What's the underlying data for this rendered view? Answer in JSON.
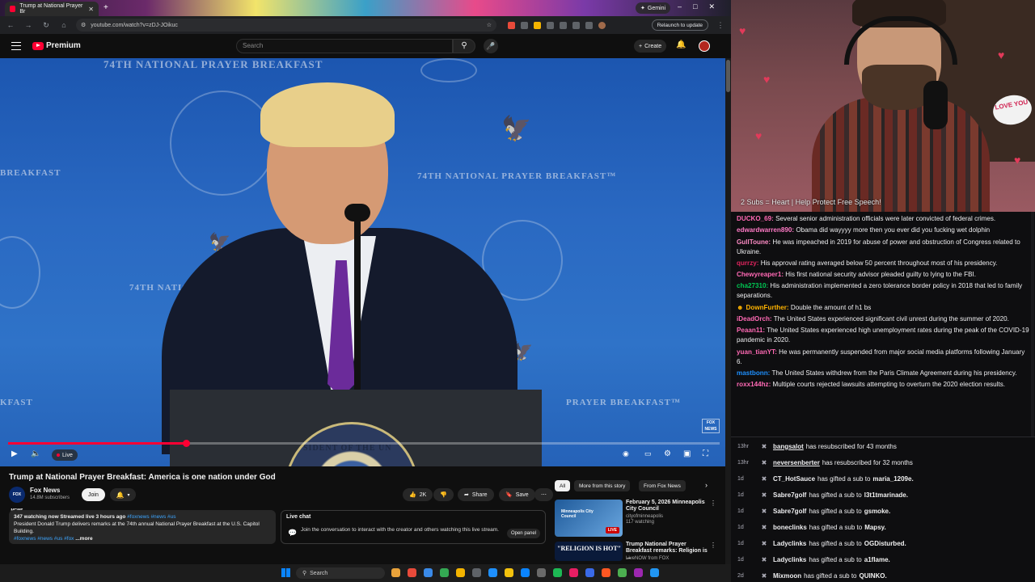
{
  "browser": {
    "tab_title": "Trump at National Prayer Br",
    "new_tab": "+",
    "url": "youtube.com/watch?v=zDJ-JOikuc",
    "gemini_label": "Gemini",
    "relaunch_label": "Relaunch to update",
    "window_controls": [
      "–",
      "□",
      "✕"
    ]
  },
  "youtube": {
    "logo_text": "Premium",
    "search_placeholder": "Search",
    "create_label": "Create",
    "video": {
      "banners": [
        "74TH NATIONAL PRAYER BREAKFAST",
        "74TH NATIONAL PRAYER BREAKFAST™",
        "74TH NATIO",
        "BREAKFAST",
        "KFAST",
        "PRAYER BREAKFAST™"
      ],
      "podium_text": "SIDENT OF THE UN",
      "fox_bug": "FOX NEWS",
      "progress_fraction": 0.25,
      "live_label": "Live"
    },
    "title": "Trump at National Prayer Breakfast: America is one nation under God",
    "channel": {
      "name": "Fox News",
      "avatar_text": "FOX NEWS",
      "subscribers": "14.8M subscribers",
      "join_label": "Join"
    },
    "actions": {
      "likes": "2K",
      "share": "Share",
      "save": "Save",
      "more": "⋯"
    },
    "description": {
      "meta": "347 watching now  Streamed live 3 hours ago",
      "meta_tags": "#foxnews #news #us",
      "text": "President Donald Trump delivers remarks at the 74th annual National Prayer Breakfast at the U.S. Capitol Building.",
      "tags": "#foxnews #news #us #fox",
      "more": "...more"
    },
    "live_chat": {
      "title": "Live chat",
      "text": "Join the conversation to interact with the creator and others watching this live stream.",
      "open_panel": "Open panel"
    },
    "chips": [
      "All",
      "More from this story",
      "From Fox News"
    ],
    "recommendations": [
      {
        "title": "February 5, 2026 Minneapolis City Council",
        "channel": "cityofminneapolis",
        "meta": "117 watching",
        "thumb_text": "Minneapolis City Council",
        "live": "LIVE",
        "accent": "#2f6fb0"
      },
      {
        "title": "Trump National Prayer Breakfast remarks: Religion is ...",
        "channel": "LiveNOW from FOX",
        "meta": "",
        "thumb_text": "\"RELIGION IS HOT\"",
        "live": "",
        "accent": "#0a1a3a"
      }
    ]
  },
  "taskbar": {
    "search_label": "Search",
    "icon_colors": [
      "#e8a23a",
      "#e84a3a",
      "#3a8ae8",
      "#34a853",
      "#f4b400",
      "#5f6368",
      "#1e90ff",
      "#f4c20d",
      "#0a84ff",
      "#6a6a6a",
      "#1db954",
      "#e81e63",
      "#3a6ae8",
      "#ff5722",
      "#4caf50",
      "#9c27b0",
      "#2196f3"
    ]
  },
  "stream": {
    "caption": "2 Subs = Heart | Help Protect Free Speech!",
    "love_sign": "LOVE YOU",
    "chat": [
      {
        "user": "DUCKO_69:",
        "color": "#ff69b4",
        "text": "Several senior administration officials were later convicted of federal crimes."
      },
      {
        "user": "edwardwarren890:",
        "color": "#ff7ac6",
        "text": "Obama did wayyyy more then you ever did you fucking wet dolphin"
      },
      {
        "user": "GullToune:",
        "color": "#ff8cc6",
        "text": "He was impeached in 2019 for abuse of power and obstruction of Congress related to Ukraine."
      },
      {
        "user": "qurrzy:",
        "color": "#e0245e",
        "text": "His approval rating averaged below 50 percent throughout most of his presidency."
      },
      {
        "user": "Chewyreaper1:",
        "color": "#ff69b4",
        "text": "His first national security advisor pleaded guilty to lying to the FBI."
      },
      {
        "user": "cha27310:",
        "color": "#00c853",
        "text": "His administration implemented a zero tolerance border policy in 2018 that led to family separations."
      },
      {
        "user": "DownFurther:",
        "color": "#ffb300",
        "text": "Double the amount of h1 bs",
        "badge": "☻"
      },
      {
        "user": "iDeadOrch:",
        "color": "#ff69b4",
        "text": "The United States experienced significant civil unrest during the summer of 2020."
      },
      {
        "user": "Peaan11:",
        "color": "#ff69b4",
        "text": "The United States experienced high unemployment rates during the peak of the COVID-19 pandemic in 2020."
      },
      {
        "user": "yuan_tianYT:",
        "color": "#ff69b4",
        "text": "He was permanently suspended from major social media platforms following January 6."
      },
      {
        "user": "mastbonn:",
        "color": "#1e90ff",
        "text": "The United States withdrew from the Paris Climate Agreement during his presidency."
      },
      {
        "user": "roxx144hz:",
        "color": "#ff69b4",
        "text": "Multiple courts rejected lawsuits attempting to overturn the 2020 election results."
      }
    ],
    "alerts": [
      {
        "time": "13hr",
        "name": "bangsalot",
        "underline": true,
        "text": "has resubscribed for 43 months",
        "target": ""
      },
      {
        "time": "13hr",
        "name": "neversenberter",
        "underline": true,
        "text": "has resubscribed for 32 months",
        "target": ""
      },
      {
        "time": "1d",
        "name": "CT_HotSauce",
        "underline": false,
        "text": "has gifted a sub to",
        "target": "maria_1209e."
      },
      {
        "time": "1d",
        "name": "Sabre7golf",
        "underline": false,
        "text": "has gifted a sub to",
        "target": "l3t1tmarinade."
      },
      {
        "time": "1d",
        "name": "Sabre7golf",
        "underline": false,
        "text": "has gifted a sub to",
        "target": "gsmoke."
      },
      {
        "time": "1d",
        "name": "boneclinks",
        "underline": false,
        "text": "has gifted a sub to",
        "target": "Mapsy."
      },
      {
        "time": "1d",
        "name": "Ladyclinks",
        "underline": false,
        "text": "has gifted a sub to",
        "target": "OGDisturbed."
      },
      {
        "time": "1d",
        "name": "Ladyclinks",
        "underline": false,
        "text": "has gifted a sub to",
        "target": "a1flame."
      },
      {
        "time": "2d",
        "name": "Mixmoon",
        "underline": false,
        "text": "has gifted a sub to",
        "target": "QUINKO."
      }
    ]
  }
}
